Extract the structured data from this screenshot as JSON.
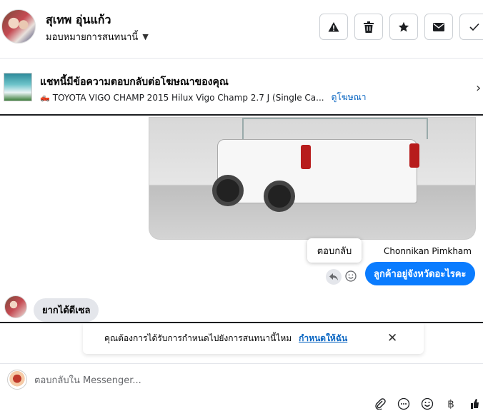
{
  "header": {
    "name": "สุเทพ อุ่นแก้ว",
    "assign_label": "มอบหมายการสนทนานี้",
    "actions": [
      "warning-icon",
      "trash-icon",
      "star-icon",
      "mail-icon",
      "check-icon"
    ]
  },
  "ad_banner": {
    "title": "แชทนี้มีข้อความตอบกลับต่อโฆษณาของคุณ",
    "subtitle": "TOYOTA VIGO CHAMP 2015 Hilux Vigo Champ 2.7 J (Single Ca...",
    "link": "ดูโฆษณา"
  },
  "messages": {
    "reply_tooltip": "ตอบกลับ",
    "sender_name": "Chonnikan Pimkham",
    "outgoing_text": "ลูกค้าอยู่จังหวัดอะไรคะ",
    "incoming_text": "ยากได้ดีเซล"
  },
  "notice": {
    "text": "คุณต้องการได้รับการกำหนดไปยังการสนทนานี้ไหม",
    "link": "กำหนดให้ฉัน"
  },
  "composer": {
    "placeholder": "ตอบกลับใน Messenger..."
  },
  "colors": {
    "accent": "#0a7cff",
    "link": "#0a66c2",
    "incoming_bubble": "#e4e6eb"
  }
}
